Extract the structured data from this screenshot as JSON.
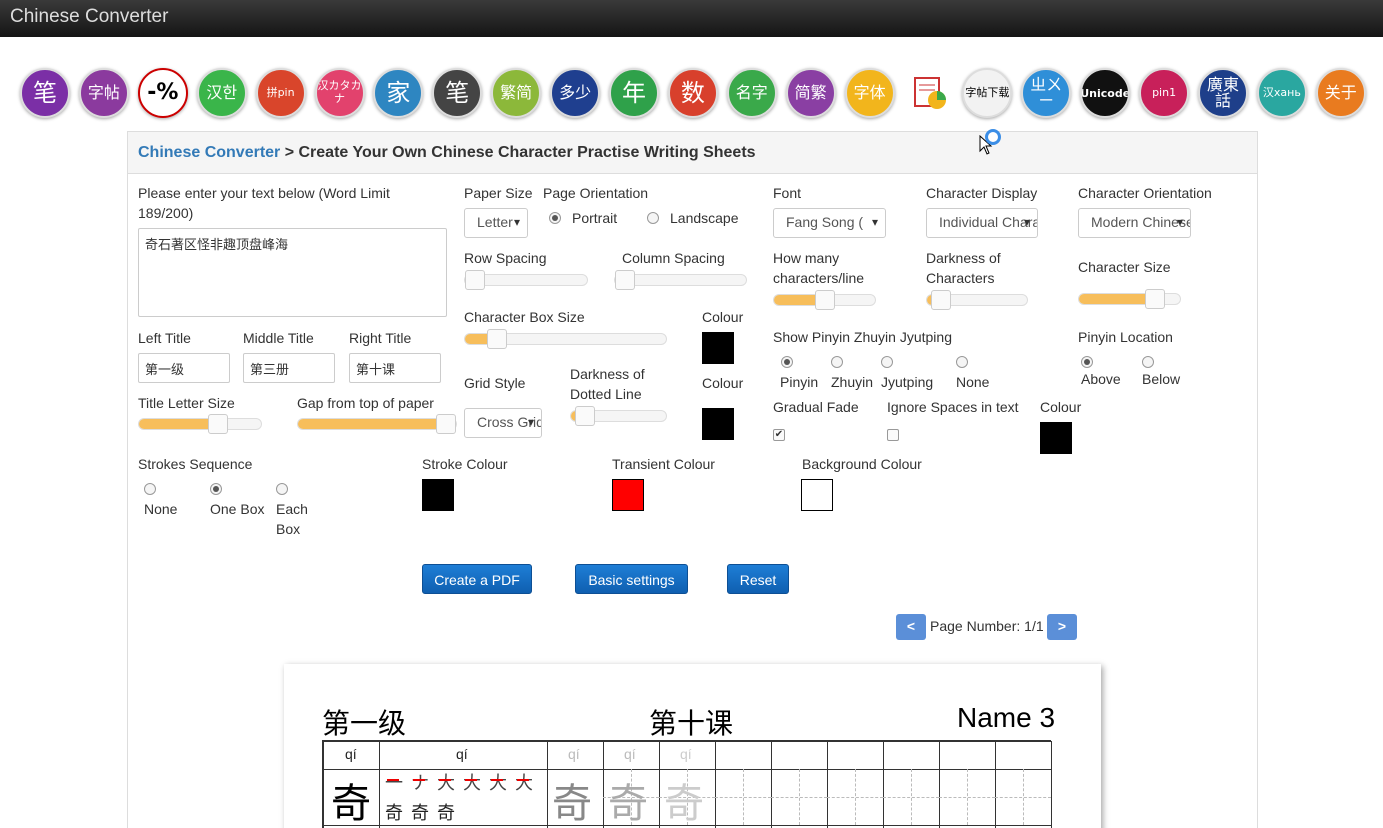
{
  "app": {
    "title": "Chinese Converter"
  },
  "nav_icons": [
    {
      "label": "笔",
      "name": "brush-stroke-tool-icon",
      "bg": "#7b2fa6"
    },
    {
      "label": "字帖",
      "name": "copybook-tool-icon",
      "bg": "#8b3a9e"
    },
    {
      "label": "-%",
      "name": "percent-tool-icon",
      "bg": "#ffffff"
    },
    {
      "label": "汉한",
      "name": "chinese-korean-tool-icon",
      "bg": "#3ab54a"
    },
    {
      "label": "拼pin",
      "name": "pinyin-tool-icon",
      "bg": "#d9452b"
    },
    {
      "label": "汉カタカナ",
      "name": "chinese-katakana-tool-icon",
      "bg": "#e2426d"
    },
    {
      "label": "家",
      "name": "family-tool-icon",
      "bg": "#2e86c1"
    },
    {
      "label": "笔",
      "name": "stroke-order-tool-icon",
      "bg": "#444444"
    },
    {
      "label": "繁简",
      "name": "traditional-simplified-tool-icon",
      "bg": "#8cb83a"
    },
    {
      "label": "多少",
      "name": "how-many-tool-icon",
      "bg": "#1f3f8f"
    },
    {
      "label": "年",
      "name": "year-tool-icon",
      "bg": "#2fa14a"
    },
    {
      "label": "数",
      "name": "number-tool-icon",
      "bg": "#d8402c"
    },
    {
      "label": "名字",
      "name": "name-tool-icon",
      "bg": "#3aa94a"
    },
    {
      "label": "简繁",
      "name": "simplified-traditional-tool-icon",
      "bg": "#8a3fa3"
    },
    {
      "label": "字体",
      "name": "font-tool-icon",
      "bg": "#f2b51c"
    },
    {
      "label": "",
      "name": "chart-document-icon",
      "bg": "#ffffff"
    },
    {
      "label": "字帖下载",
      "name": "copybook-download-tool-icon",
      "bg": "#f2f2f2"
    },
    {
      "label": "ㄓㄨㄧ",
      "name": "zhuyin-tool-icon",
      "bg": "#2f8fd8"
    },
    {
      "label": "Unicode",
      "name": "unicode-tool-icon",
      "bg": "#111111"
    },
    {
      "label": "pin1",
      "name": "pin1-tool-icon",
      "bg": "#c8205a"
    },
    {
      "label": "廣東話",
      "name": "cantonese-tool-icon",
      "bg": "#1e3f8a"
    },
    {
      "label": "汉xaнь",
      "name": "chinese-cyrillic-tool-icon",
      "bg": "#2aa7a0"
    },
    {
      "label": "关于",
      "name": "about-tool-icon",
      "bg": "#e97b1f"
    }
  ],
  "breadcrumb": {
    "link": "Chinese Converter",
    "sep": " > ",
    "current": "Create Your Own Chinese Character Practise Writing Sheets"
  },
  "form": {
    "text_label": "Please enter your text below (Word Limit 189/200)",
    "text_value": "奇石著区怪非趣顶盘峰海",
    "left_title_label": "Left Title",
    "left_title_value": "第一级",
    "middle_title_label": "Middle Title",
    "middle_title_value": "第三册",
    "right_title_label": "Right Title",
    "right_title_value": "第十课",
    "title_letter_size_label": "Title Letter Size",
    "title_letter_size_level": 0.68,
    "gap_from_top_label": "Gap from top of paper",
    "gap_from_top_level": 1.0,
    "paper_size_label": "Paper Size",
    "paper_size_value": "Letter",
    "page_orientation_label": "Page Orientation",
    "portrait_label": "Portrait",
    "landscape_label": "Landscape",
    "row_spacing_label": "Row Spacing",
    "row_spacing_level": 0.0,
    "column_spacing_label": "Column Spacing",
    "column_spacing_level": 0.0,
    "char_box_size_label": "Character Box Size",
    "char_box_size_level": 0.12,
    "colour_label": "Colour",
    "grid_colour": "#000000",
    "grid_style_label": "Grid Style",
    "grid_style_value": "Cross Grid",
    "dotted_darkness_label": "Darkness of Dotted Line",
    "dotted_darkness_level": 0.05,
    "dotted_colour": "#000000",
    "font_label": "Font",
    "font_value": "Fang Song (",
    "char_display_label": "Character Display",
    "char_display_value": "Individual Characters",
    "char_orientation_label": "Character Orientation",
    "char_orientation_value": "Modern Chinese",
    "chars_per_line_label": "How many characters/line",
    "chars_per_line_level": 0.5,
    "char_darkness_label": "Darkness of Characters",
    "char_darkness_level": 0.05,
    "char_size_label": "Character Size",
    "char_size_level": 0.82,
    "show_pinyin_label": "Show Pinyin Zhuyin Jyutping",
    "pinyin_opt": "Pinyin",
    "zhuyin_opt": "Zhuyin",
    "jyutping_opt": "Jyutping",
    "none_opt": "None",
    "pinyin_location_label": "Pinyin Location",
    "above_opt": "Above",
    "below_opt": "Below",
    "gradual_fade_label": "Gradual Fade",
    "ignore_spaces_label": "Ignore Spaces in text",
    "fade_colour": "#000000",
    "strokes_seq_label": "Strokes Sequence",
    "none_stroke_opt": "None",
    "one_box_opt": "One Box",
    "each_box_opt": "Each Box",
    "stroke_colour_label": "Stroke Colour",
    "stroke_colour": "#000000",
    "transient_colour_label": "Transient Colour",
    "transient_colour": "#ff0000",
    "background_colour_label": "Background Colour",
    "background_colour": "#ffffff"
  },
  "buttons": {
    "create_pdf": "Create a PDF",
    "basic_settings": "Basic settings",
    "reset": "Reset"
  },
  "pager": {
    "prev": "<",
    "next": ">",
    "label": "Page Number: 1/1"
  },
  "sheet": {
    "left_title": "第一级",
    "middle_title": "第十课",
    "right_title": "Name 3",
    "pinyin": "qí",
    "char": "奇",
    "stroke_steps": [
      "一",
      "ナ",
      "大",
      "大",
      "大",
      "大",
      "奇",
      "奇",
      "奇"
    ]
  }
}
